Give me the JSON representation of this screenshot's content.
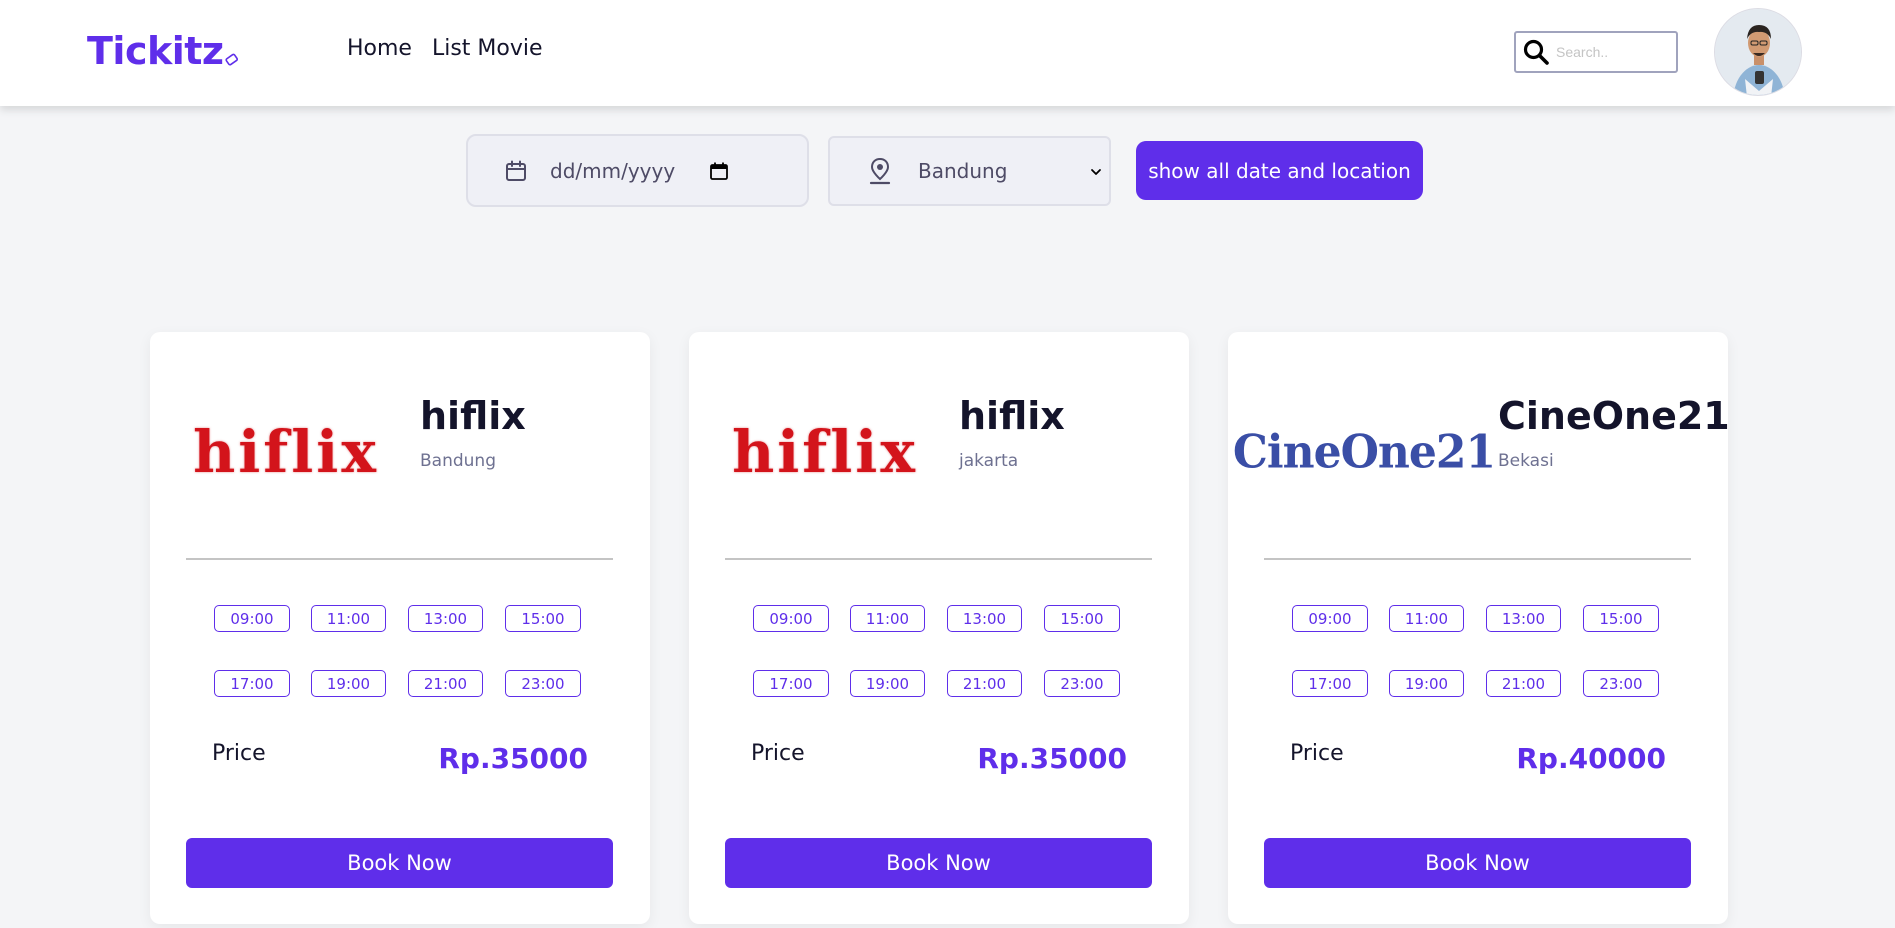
{
  "brand": {
    "name": "Tickitz",
    "color": "#5f2eea"
  },
  "nav": {
    "links": [
      {
        "label": "Home"
      },
      {
        "label": "List Movie"
      }
    ]
  },
  "search": {
    "placeholder": "Search..",
    "icon": "search-icon"
  },
  "user": {
    "avatar": "avatar"
  },
  "filters": {
    "date_placeholder": "dd/mm/yyyy",
    "location_selected": "Bandung",
    "show_all_label": "show all date and location"
  },
  "cinemas": [
    {
      "logo_text": "hiflix",
      "name": "hiflix",
      "location": "Bandung",
      "times": [
        "09:00",
        "11:00",
        "13:00",
        "15:00",
        "17:00",
        "19:00",
        "21:00",
        "23:00"
      ],
      "price_label": "Price",
      "price": "Rp.35000",
      "book_label": "Book Now"
    },
    {
      "logo_text": "hiflix",
      "name": "hiflix",
      "location": "jakarta",
      "times": [
        "09:00",
        "11:00",
        "13:00",
        "15:00",
        "17:00",
        "19:00",
        "21:00",
        "23:00"
      ],
      "price_label": "Price",
      "price": "Rp.35000",
      "book_label": "Book Now"
    },
    {
      "logo_text": "CineOne21",
      "name": "CineOne21",
      "location": "Bekasi",
      "times": [
        "09:00",
        "11:00",
        "13:00",
        "15:00",
        "17:00",
        "19:00",
        "21:00",
        "23:00"
      ],
      "price_label": "Price",
      "price": "Rp.40000",
      "book_label": "Book Now"
    }
  ],
  "colors": {
    "accent": "#5f2eea",
    "hiflix_red": "#d3141b",
    "cineone_blue": "#3a4ea6",
    "background": "#f4f5f7"
  }
}
